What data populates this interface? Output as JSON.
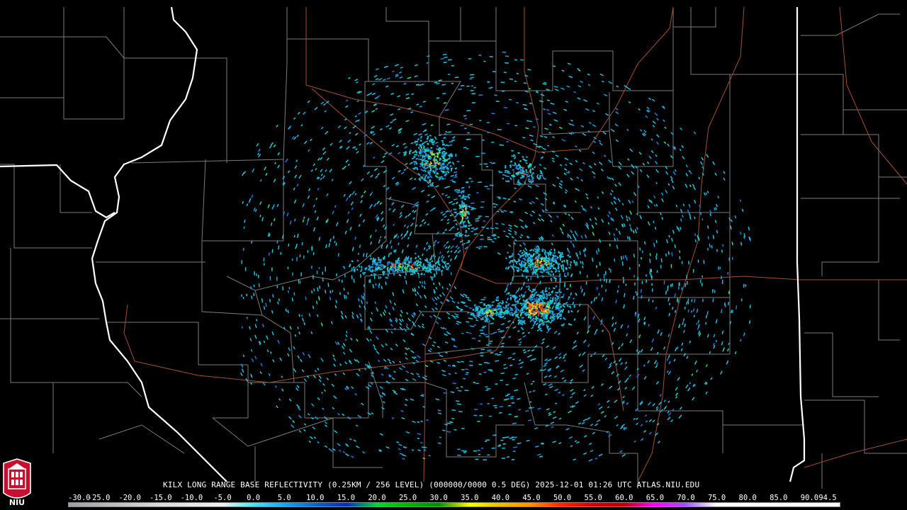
{
  "radar": {
    "caption": "KILX LONG RANGE BASE REFLECTIVITY (0.25KM / 256 LEVEL) (000000/0000 0.5 DEG) 2025-12-01 01:26 UTC  ATLAS.NIU.EDU",
    "site": "KILX",
    "product": "LONG RANGE BASE REFLECTIVITY",
    "timestamp": "2025-12-01 01:26 UTC",
    "source": "ATLAS.NIU.EDU"
  },
  "scale": {
    "labels": [
      "-30.0",
      "-25.0",
      "-20.0",
      "-15.0",
      "-10.0",
      "-5.0",
      "0.0",
      "5.0",
      "10.0",
      "15.0",
      "20.0",
      "25.0",
      "30.0",
      "35.0",
      "40.0",
      "45.0",
      "50.0",
      "55.0",
      "60.0",
      "65.0",
      "70.0",
      "75.0",
      "80.0",
      "85.0",
      "90.0",
      "94.5"
    ],
    "colors": [
      "#9aa0a6",
      "#b4b4b4",
      "#c8c8c8",
      "#dcdcdc",
      "#e8e8e8",
      "#f0f0f0",
      "#4fe3f0",
      "#11a8e8",
      "#1060c8",
      "#0a2cb8",
      "#00d838",
      "#00b400",
      "#008c00",
      "#ffff00",
      "#e8c000",
      "#ff9000",
      "#ff2000",
      "#d00000",
      "#b40000",
      "#ff00ff",
      "#a050ff",
      "#ffffff",
      "#ffffff",
      "#ffffff",
      "#ffffff"
    ]
  },
  "logo": {
    "text": "NIU",
    "color": "#c8102e"
  },
  "map": {
    "state_border_color": "#ffffff",
    "county_line_color": "#7a7a7a",
    "highway_color": "#a0522d",
    "echo_colors": [
      "#22c0d8",
      "#1aa0d8",
      "#2a70d8",
      "#20e0a0",
      "#30d040",
      "#e0e020",
      "#f0a020",
      "#e03020"
    ]
  }
}
